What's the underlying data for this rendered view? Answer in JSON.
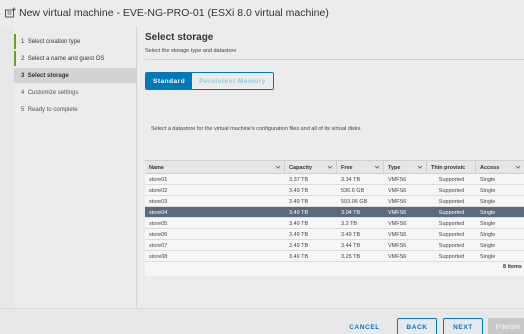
{
  "window": {
    "title": "New virtual machine - EVE-NG-PRO-01 (ESXi 8.0 virtual machine)",
    "icon": "new-vm-icon"
  },
  "steps": [
    {
      "number": "1",
      "label": "Select creation type",
      "state": "done"
    },
    {
      "number": "2",
      "label": "Select a name and guest OS",
      "state": "done"
    },
    {
      "number": "3",
      "label": "Select storage",
      "state": "active"
    },
    {
      "number": "4",
      "label": "Customize settings",
      "state": "pending"
    },
    {
      "number": "5",
      "label": "Ready to complete",
      "state": "pending"
    }
  ],
  "main": {
    "heading": "Select storage",
    "subheading": "Select the storage type and datastore",
    "tabs": [
      {
        "label": "Standard",
        "selected": true
      },
      {
        "label": "Persistent Memory",
        "selected": false
      }
    ],
    "description": "Select a datastore for the virtual machine's configuration files and all of its virtual disks."
  },
  "datastores": {
    "columns": [
      "Name",
      "Capacity",
      "Free",
      "Type",
      "Thin provisic",
      "Access"
    ],
    "rows": [
      {
        "name": "store01",
        "capacity": "3.37 TB",
        "free": "3.34 TB",
        "type": "VMFS6",
        "thin": "Supported",
        "access": "Single",
        "selected": false
      },
      {
        "name": "store02",
        "capacity": "3.49 TB",
        "free": "536.6 GB",
        "type": "VMFS6",
        "thin": "Supported",
        "access": "Single",
        "selected": false
      },
      {
        "name": "store03",
        "capacity": "3.49 TB",
        "free": "503.06 GB",
        "type": "VMFS6",
        "thin": "Supported",
        "access": "Single",
        "selected": false
      },
      {
        "name": "store04",
        "capacity": "3.49 TB",
        "free": "3.04 TB",
        "type": "VMFS6",
        "thin": "Supported",
        "access": "Single",
        "selected": true
      },
      {
        "name": "store05",
        "capacity": "3.49 TB",
        "free": "3.2 TB",
        "type": "VMFS6",
        "thin": "Supported",
        "access": "Single",
        "selected": false
      },
      {
        "name": "store06",
        "capacity": "3.49 TB",
        "free": "3.49 TB",
        "type": "VMFS6",
        "thin": "Supported",
        "access": "Single",
        "selected": false
      },
      {
        "name": "store07",
        "capacity": "3.49 TB",
        "free": "3.44 TB",
        "type": "VMFS6",
        "thin": "Supported",
        "access": "Single",
        "selected": false
      },
      {
        "name": "store08",
        "capacity": "3.49 TB",
        "free": "3.25 TB",
        "type": "VMFS6",
        "thin": "Supported",
        "access": "Single",
        "selected": false
      }
    ],
    "count_label": "8 items"
  },
  "buttons": {
    "cancel": "CANCEL",
    "back": "BACK",
    "next": "NEXT",
    "finish": "FINISH"
  },
  "colors": {
    "accent": "#0079b8",
    "step_done": "#62a420",
    "selected_row": "#5a6b7c"
  }
}
